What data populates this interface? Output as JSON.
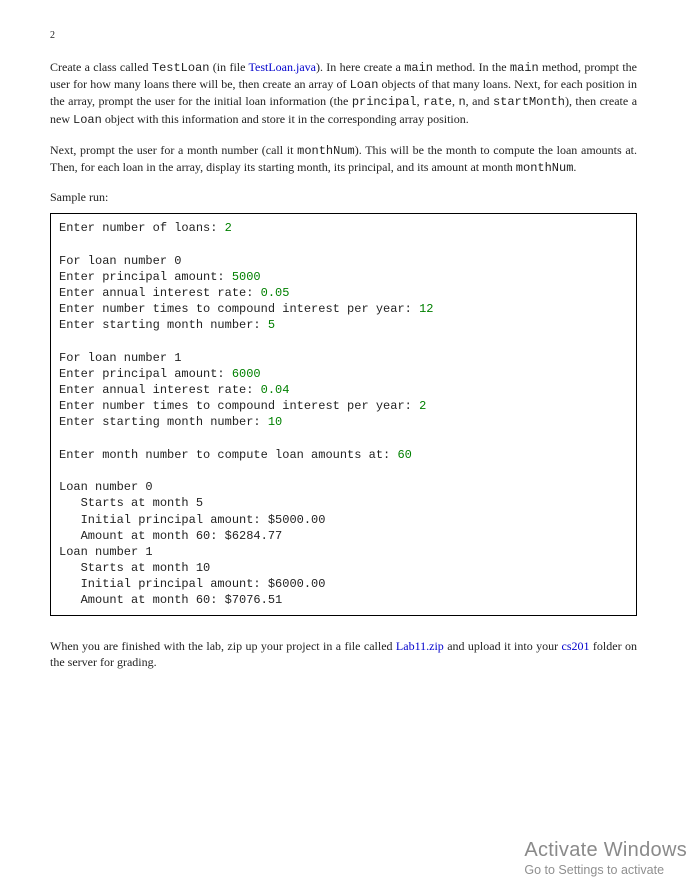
{
  "page_number": "2",
  "para1": {
    "t1": "Create a class called ",
    "c1": "TestLoan",
    "t2": " (in file ",
    "l1": "TestLoan.java",
    "t3": "). In here create a ",
    "c2": "main",
    "t4": " method. In the ",
    "c3": "main",
    "t5": " method, prompt the user for how many loans there will be, then create an array of ",
    "c4": "Loan",
    "t6": " objects of that many loans. Next, for each position in the array, prompt the user for the initial loan information (the ",
    "c5": "principal",
    "t7": ", ",
    "c6": "rate",
    "t8": ", ",
    "c7": "n",
    "t9": ", and ",
    "c8": "startMonth",
    "t10": "), then create a new ",
    "c9": "Loan",
    "t11": " object with this information and store it in the corresponding array position."
  },
  "para2": {
    "t1": "Next, prompt the user for a month number (call it ",
    "c1": "monthNum",
    "t2": ").  This will be the month to compute the loan amounts at.  Then, for each loan in the array, display its starting month, its principal, and its amount at month ",
    "c2": "monthNum",
    "t3": "."
  },
  "sample_label": "Sample run:",
  "code": {
    "l1a": "Enter number of loans: ",
    "l1g": "2",
    "l2": "",
    "l3": "For loan number 0",
    "l4a": "Enter principal amount: ",
    "l4g": "5000",
    "l5a": "Enter annual interest rate: ",
    "l5g": "0.05",
    "l6a": "Enter number times to compound interest per year: ",
    "l6g": "12",
    "l7a": "Enter starting month number: ",
    "l7g": "5",
    "l8": "",
    "l9": "For loan number 1",
    "l10a": "Enter principal amount: ",
    "l10g": "6000",
    "l11a": "Enter annual interest rate: ",
    "l11g": "0.04",
    "l12a": "Enter number times to compound interest per year: ",
    "l12g": "2",
    "l13a": "Enter starting month number: ",
    "l13g": "10",
    "l14": "",
    "l15a": "Enter month number to compute loan amounts at: ",
    "l15g": "60",
    "l16": "",
    "l17": "Loan number 0",
    "l18": "   Starts at month 5",
    "l19": "   Initial principal amount: $5000.00",
    "l20": "   Amount at month 60: $6284.77",
    "l21": "Loan number 1",
    "l22": "   Starts at month 10",
    "l23": "   Initial principal amount: $6000.00",
    "l24": "   Amount at month 60: $7076.51"
  },
  "para3": {
    "t1": "When you are finished with the lab, zip up your project in a file called ",
    "l1": "Lab11.zip",
    "t2": " and upload it into your ",
    "l2": "cs201",
    "t3": " folder on the server for grading."
  },
  "watermark": {
    "title": "Activate Windows",
    "sub": "Go to Settings to activate"
  }
}
